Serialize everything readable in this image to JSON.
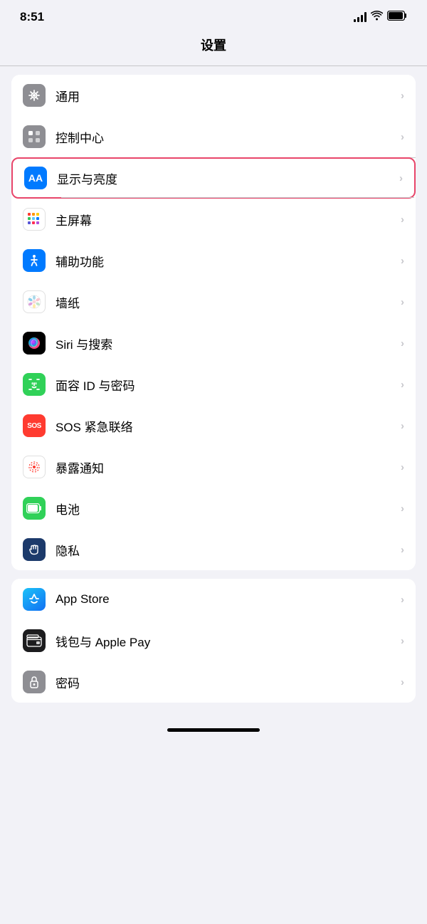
{
  "statusBar": {
    "time": "8:51"
  },
  "pageTitle": "设置",
  "groups": [
    {
      "id": "group1",
      "items": [
        {
          "id": "general",
          "label": "通用",
          "iconBg": "icon-gray",
          "iconType": "gear",
          "highlighted": false
        },
        {
          "id": "control-center",
          "label": "控制中心",
          "iconBg": "icon-gray",
          "iconType": "toggles",
          "highlighted": false
        },
        {
          "id": "display",
          "label": "显示与亮度",
          "iconBg": "icon-blue",
          "iconType": "aa",
          "highlighted": true
        },
        {
          "id": "home-screen",
          "label": "主屏幕",
          "iconBg": "icon-multicolor",
          "iconType": "grid",
          "highlighted": false
        },
        {
          "id": "accessibility",
          "label": "辅助功能",
          "iconBg": "icon-blue",
          "iconType": "accessibility",
          "highlighted": false
        },
        {
          "id": "wallpaper",
          "label": "墙纸",
          "iconBg": "icon-flower",
          "iconType": "flower",
          "highlighted": false
        },
        {
          "id": "siri",
          "label": "Siri 与搜索",
          "iconBg": "icon-siri",
          "iconType": "siri",
          "highlighted": false
        },
        {
          "id": "faceid",
          "label": "面容 ID 与密码",
          "iconBg": "icon-green-faceid",
          "iconType": "faceid",
          "highlighted": false
        },
        {
          "id": "sos",
          "label": "SOS 紧急联络",
          "iconBg": "icon-red-sos",
          "iconType": "sos",
          "highlighted": false
        },
        {
          "id": "exposure",
          "label": "暴露通知",
          "iconBg": "icon-exposure",
          "iconType": "exposure",
          "highlighted": false
        },
        {
          "id": "battery",
          "label": "电池",
          "iconBg": "icon-battery",
          "iconType": "battery",
          "highlighted": false
        },
        {
          "id": "privacy",
          "label": "隐私",
          "iconBg": "icon-privacy",
          "iconType": "hand",
          "highlighted": false
        }
      ]
    },
    {
      "id": "group2",
      "items": [
        {
          "id": "appstore",
          "label": "App Store",
          "iconBg": "icon-appstore",
          "iconType": "appstore",
          "highlighted": false
        },
        {
          "id": "wallet",
          "label": "钱包与 Apple Pay",
          "iconBg": "icon-wallet",
          "iconType": "wallet",
          "highlighted": false
        },
        {
          "id": "password",
          "label": "密码",
          "iconBg": "icon-password",
          "iconType": "password",
          "highlighted": false
        }
      ]
    }
  ],
  "chevron": "›"
}
